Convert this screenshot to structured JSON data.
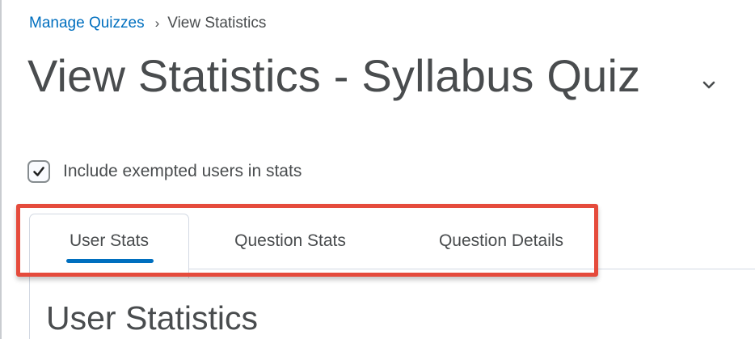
{
  "breadcrumb": {
    "parent_label": "Manage Quizzes",
    "separator": "›",
    "current_label": "View Statistics"
  },
  "page": {
    "title": "View Statistics - Syllabus Quiz",
    "title_menu_icon": "chevron-down-icon"
  },
  "options": {
    "include_exempted_label": "Include exempted users in stats",
    "include_exempted_checked": true
  },
  "tabs": [
    {
      "label": "User Stats",
      "selected": true
    },
    {
      "label": "Question Stats",
      "selected": false
    },
    {
      "label": "Question Details",
      "selected": false
    }
  ],
  "section": {
    "title": "User Statistics"
  },
  "colors": {
    "link": "#006fbf",
    "text": "#494c4e",
    "highlight_outline": "#e54b3c",
    "tab_indicator": "#006fbf"
  }
}
